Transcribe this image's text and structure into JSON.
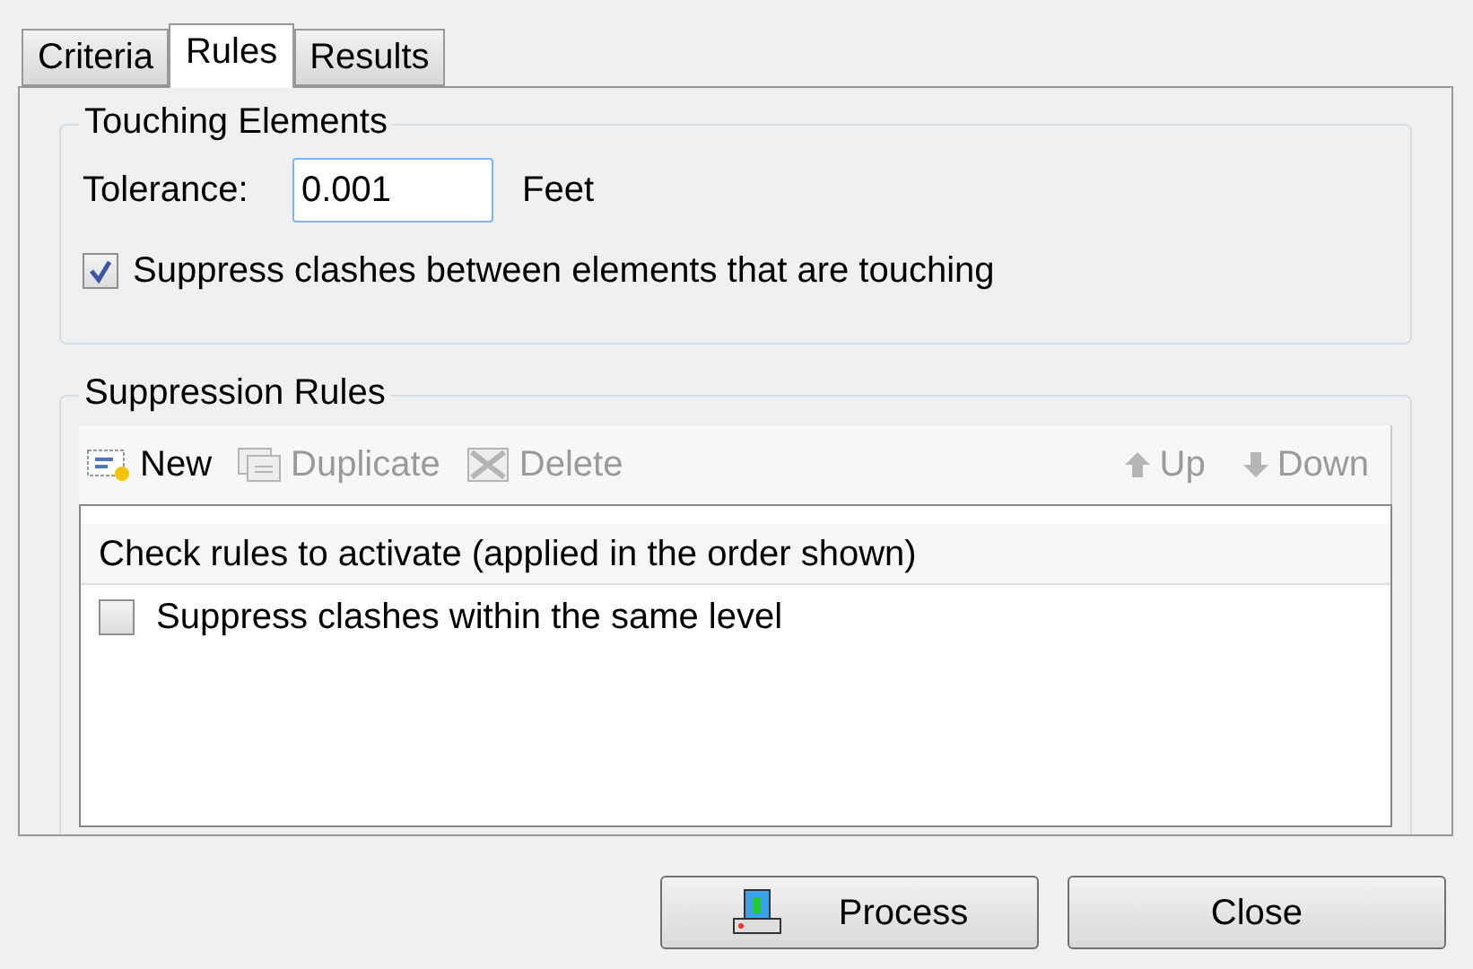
{
  "tabs": [
    {
      "label": "Criteria",
      "selected": false
    },
    {
      "label": "Rules",
      "selected": true
    },
    {
      "label": "Results",
      "selected": false
    }
  ],
  "touching_elements": {
    "title": "Touching Elements",
    "tolerance_label": "Tolerance:",
    "tolerance_value": "0.001",
    "unit": "Feet",
    "suppress_touching": {
      "label": "Suppress clashes between elements that are touching",
      "checked": true
    }
  },
  "suppression_rules": {
    "title": "Suppression Rules",
    "toolbar": [
      {
        "kind": "new",
        "label": "New",
        "disabled": false
      },
      {
        "kind": "duplicate",
        "label": "Duplicate",
        "disabled": true
      },
      {
        "kind": "delete",
        "label": "Delete",
        "disabled": true
      },
      {
        "kind": "up",
        "label": "Up",
        "disabled": true
      },
      {
        "kind": "down",
        "label": "Down",
        "disabled": true
      }
    ],
    "list_header": "Check rules to activate (applied in the order shown)",
    "rules": [
      {
        "label": "Suppress clashes within the same level",
        "checked": false
      }
    ]
  },
  "buttons": [
    {
      "kind": "process",
      "label": "Process"
    },
    {
      "kind": "close",
      "label": "Close"
    }
  ]
}
